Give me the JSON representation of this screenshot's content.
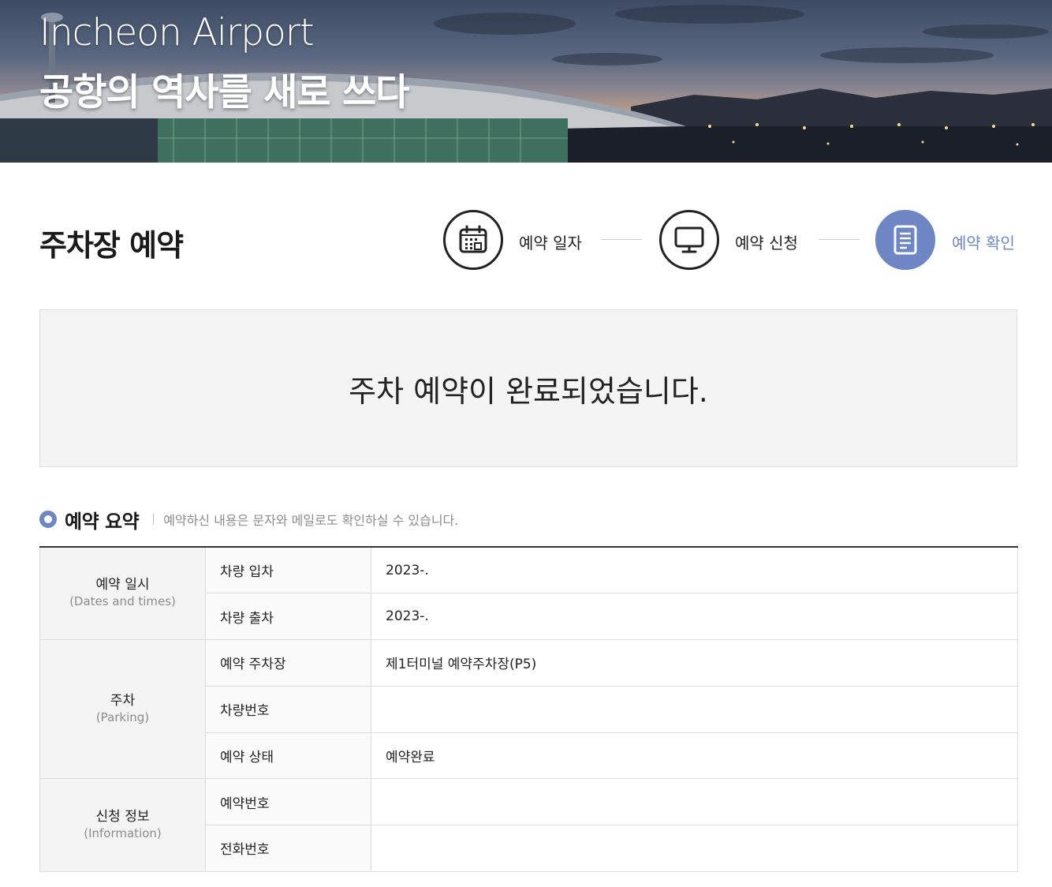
{
  "hero": {
    "title_en": "Incheon Airport",
    "title_ko": "공항의 역사를 새로 쓰다"
  },
  "page": {
    "title": "주차장 예약"
  },
  "steps": [
    {
      "label": "예약 일자",
      "icon": "calendar-icon",
      "active": false
    },
    {
      "label": "예약 신청",
      "icon": "monitor-icon",
      "active": false
    },
    {
      "label": "예약 확인",
      "icon": "document-icon",
      "active": true
    }
  ],
  "completion": {
    "message": "주차 예약이 완료되었습니다."
  },
  "summary": {
    "title": "예약 요약",
    "note": "예약하신 내용은 문자와 메일로도 확인하실 수 있습니다.",
    "groups": [
      {
        "name": "예약 일시",
        "name_en": "(Dates and times)",
        "rows": [
          {
            "label": "차량 입차",
            "value": "2023-."
          },
          {
            "label": "차량 출차",
            "value": "2023-."
          }
        ]
      },
      {
        "name": "주차",
        "name_en": "(Parking)",
        "rows": [
          {
            "label": "예약 주차장",
            "value": "제1터미널 예약주차장(P5)"
          },
          {
            "label": "차량번호",
            "value": ""
          },
          {
            "label": "예약 상태",
            "value": "예약완료"
          }
        ]
      },
      {
        "name": "신청 정보",
        "name_en": "(Information)",
        "rows": [
          {
            "label": "예약번호",
            "value": ""
          },
          {
            "label": "전화번호",
            "value": ""
          }
        ]
      }
    ]
  },
  "colors": {
    "accent": "#6f86c5",
    "text": "#222222",
    "muted": "#8c8c8c"
  }
}
